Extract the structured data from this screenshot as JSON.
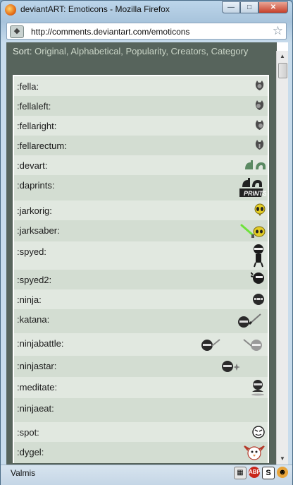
{
  "window": {
    "title": "deviantART: Emoticons - Mozilla Firefox"
  },
  "address": {
    "url": "http://comments.deviantart.com/emoticons"
  },
  "sort": {
    "label": "Sort:",
    "options": [
      "Original",
      "Alphabetical",
      "Popularity",
      "Creators",
      "Category"
    ]
  },
  "emoticons": [
    {
      "code": ":fella:",
      "icon": "fella-icon"
    },
    {
      "code": ":fellaleft:",
      "icon": "fellaleft-icon"
    },
    {
      "code": ":fellaright:",
      "icon": "fellaright-icon"
    },
    {
      "code": ":fellarectum:",
      "icon": "fellarectum-icon"
    },
    {
      "code": ":devart:",
      "icon": "devart-logo-icon"
    },
    {
      "code": ":daprints:",
      "icon": "daprints-logo-icon"
    },
    {
      "code": ":jarkorig:",
      "icon": "jark-alien-icon"
    },
    {
      "code": ":jarksaber:",
      "icon": "jark-saber-icon"
    },
    {
      "code": ":spyed:",
      "icon": "spyed-ninja-icon"
    },
    {
      "code": ":spyed2:",
      "icon": "spyed2-ninja-icon"
    },
    {
      "code": ":ninja:",
      "icon": "ninja-icon"
    },
    {
      "code": ":katana:",
      "icon": "katana-ninja-icon"
    },
    {
      "code": ":ninjabattle:",
      "icon": "ninja-battle-icon"
    },
    {
      "code": ":ninjastar:",
      "icon": "ninja-star-icon"
    },
    {
      "code": ":meditate:",
      "icon": "meditating-ninja-icon"
    },
    {
      "code": ":ninjaeat:",
      "icon": "ninja-eat-icon"
    },
    {
      "code": ":spot:",
      "icon": "spot-face-icon"
    },
    {
      "code": ":dygel:",
      "icon": "dygel-bird-icon"
    }
  ],
  "status": {
    "text": "Valmis",
    "icons": [
      "calculator-icon",
      "adblock-icon",
      "s-icon",
      "monkey-icon"
    ],
    "adblock_label": "ABP",
    "s_label": "S"
  },
  "colors": {
    "sortbar": "#57645c",
    "row_odd": "#e1e8e0",
    "row_even": "#d3ddd2"
  }
}
